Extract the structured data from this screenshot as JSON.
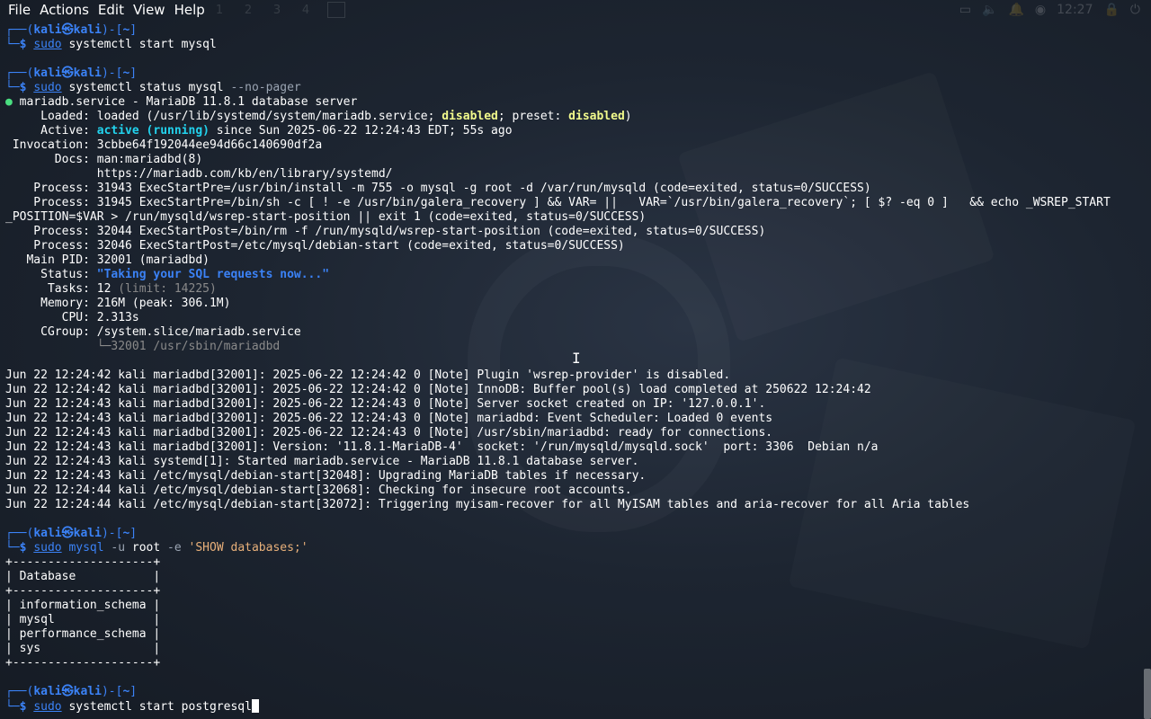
{
  "menubar": {
    "items": [
      "File",
      "Actions",
      "Edit",
      "View",
      "Help"
    ],
    "workspaces": [
      "1",
      "2",
      "3",
      "4"
    ],
    "clock": "12:27"
  },
  "prompt": {
    "top": "┌──(",
    "user": "kali",
    "at": "㉿",
    "host": "kali",
    "mid": ")-[",
    "dir": "~",
    "end": "]",
    "bottom": "└─",
    "dollar": "$"
  },
  "commands": [
    {
      "cmd": "sudo",
      "rest": " systemctl start mysql"
    },
    {
      "cmd": "sudo",
      "rest": " systemctl status mysql",
      "opt": " --no-pager"
    },
    {
      "cmd": "sudo",
      "rest1": " mysql",
      "opt": " -u",
      "rest2": " root",
      "opt2": " -e",
      "str": " 'SHOW databases;'"
    },
    {
      "cmd": "sudo",
      "rest": " systemctl start postgresql"
    }
  ],
  "status": {
    "bullet": "●",
    "header": " mariadb.service - MariaDB 11.8.1 database server",
    "loaded_pre": "     Loaded: loaded (/usr/lib/systemd/system/mariadb.service; ",
    "loaded_dis1": "disabled",
    "loaded_mid": "; preset: ",
    "loaded_dis2": "disabled",
    "loaded_end": ")",
    "active_pre": "     Active: ",
    "active_state": "active (running)",
    "active_post": " since Sun 2025-06-22 12:24:43 EDT; 55s ago",
    "invocation": " Invocation: 3cbbe64f192044ee94d66c140690df2a",
    "docs1": "       Docs: man:mariadbd(8)",
    "docs2": "             https://mariadb.com/kb/en/library/systemd/",
    "proc1": "    Process: 31943 ExecStartPre=/usr/bin/install -m 755 -o mysql -g root -d /var/run/mysqld (code=exited, status=0/SUCCESS)",
    "proc2a": "    Process: 31945 ExecStartPre=/bin/sh -c [ ! -e /usr/bin/galera_recovery ] && VAR= ||   VAR=`/usr/bin/galera_recovery`; [ $? -eq 0 ]   && echo _WSREP_START",
    "proc2b": "_POSITION=$VAR > /run/mysqld/wsrep-start-position || exit 1 (code=exited, status=0/SUCCESS)",
    "proc3": "    Process: 32044 ExecStartPost=/bin/rm -f /run/mysqld/wsrep-start-position (code=exited, status=0/SUCCESS)",
    "proc4": "    Process: 32046 ExecStartPost=/etc/mysql/debian-start (code=exited, status=0/SUCCESS)",
    "mainpid": "   Main PID: 32001 (mariadbd)",
    "status_pre": "     Status: ",
    "status_val": "\"Taking your SQL requests now...\"",
    "tasks_pre": "      Tasks: 12",
    "tasks_limit": " (limit: 14225)",
    "memory": "     Memory: 216M (peak: 306.1M)",
    "cpu": "        CPU: 2.313s",
    "cgroup": "     CGroup: /system.slice/mariadb.service",
    "cgroup2": "             └─32001 /usr/sbin/mariadbd"
  },
  "logs": [
    "Jun 22 12:24:42 kali mariadbd[32001]: 2025-06-22 12:24:42 0 [Note] Plugin 'wsrep-provider' is disabled.",
    "Jun 22 12:24:42 kali mariadbd[32001]: 2025-06-22 12:24:42 0 [Note] InnoDB: Buffer pool(s) load completed at 250622 12:24:42",
    "Jun 22 12:24:43 kali mariadbd[32001]: 2025-06-22 12:24:43 0 [Note] Server socket created on IP: '127.0.0.1'.",
    "Jun 22 12:24:43 kali mariadbd[32001]: 2025-06-22 12:24:43 0 [Note] mariadbd: Event Scheduler: Loaded 0 events",
    "Jun 22 12:24:43 kali mariadbd[32001]: 2025-06-22 12:24:43 0 [Note] /usr/sbin/mariadbd: ready for connections.",
    "Jun 22 12:24:43 kali mariadbd[32001]: Version: '11.8.1-MariaDB-4'  socket: '/run/mysqld/mysqld.sock'  port: 3306  Debian n/a",
    "Jun 22 12:24:43 kali systemd[1]: Started mariadb.service - MariaDB 11.8.1 database server.",
    "Jun 22 12:24:43 kali /etc/mysql/debian-start[32048]: Upgrading MariaDB tables if necessary.",
    "Jun 22 12:24:44 kali /etc/mysql/debian-start[32068]: Checking for insecure root accounts.",
    "Jun 22 12:24:44 kali /etc/mysql/debian-start[32072]: Triggering myisam-recover for all MyISAM tables and aria-recover for all Aria tables"
  ],
  "db_table": {
    "border": "+--------------------+",
    "header": "| Database           |",
    "rows": [
      "| information_schema |",
      "| mysql              |",
      "| performance_schema |",
      "| sys                |"
    ]
  }
}
